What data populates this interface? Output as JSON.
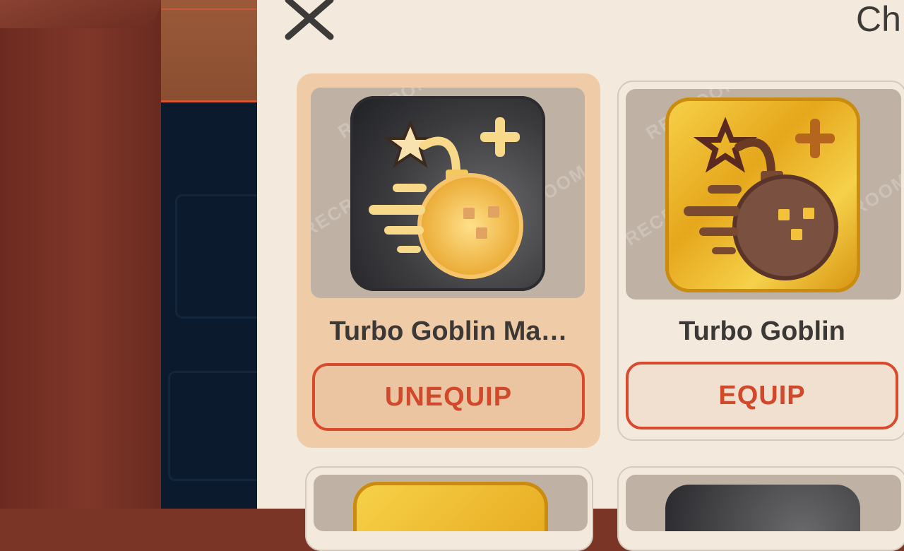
{
  "panel": {
    "title": "Ch",
    "close_icon": "close-icon"
  },
  "items": [
    {
      "name": "Turbo Goblin Ma…",
      "action_label": "UNEQUIP",
      "state": "equipped",
      "icon": "bomb-plus-icon",
      "icon_style": "dark",
      "watermark": "RECROOM"
    },
    {
      "name": "Turbo Goblin",
      "action_label": "EQUIP",
      "state": "unequipped",
      "icon": "bomb-plus-icon",
      "icon_style": "gold",
      "watermark": "RECROOM"
    }
  ],
  "colors": {
    "accent": "#d94a2c",
    "panel_bg": "#f3e9dc",
    "equipped_bg": "#f0cba8",
    "gold": "#f0c23a"
  }
}
